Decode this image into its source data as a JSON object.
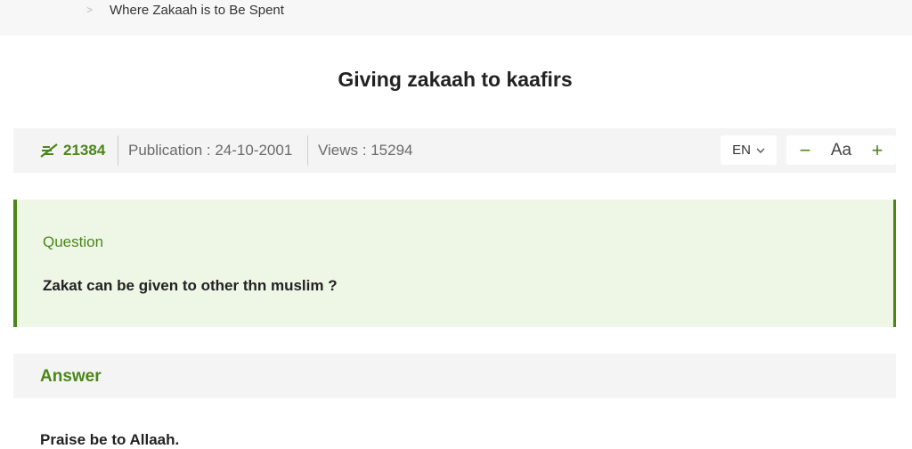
{
  "breadcrumb": {
    "item": "Where Zakaah is to Be Spent"
  },
  "page": {
    "title": "Giving zakaah to kaafirs"
  },
  "meta": {
    "id": "21384",
    "publication": "Publication : 24-10-2001",
    "views": "Views : 15294",
    "language": "EN",
    "font_label": "Aa",
    "decrease": "−",
    "increase": "+"
  },
  "question": {
    "label": "Question",
    "text": "Zakat can be given to other thn muslim ?"
  },
  "answer": {
    "label": "Answer",
    "text": "Praise be to Allaah."
  },
  "colors": {
    "accent": "#4b8619",
    "question_bg": "#eef7e6",
    "bar_bg": "#f4f4f4"
  },
  "icons": {
    "id_icon": "feather-icon",
    "lang_icon": "chevron-down-icon"
  }
}
